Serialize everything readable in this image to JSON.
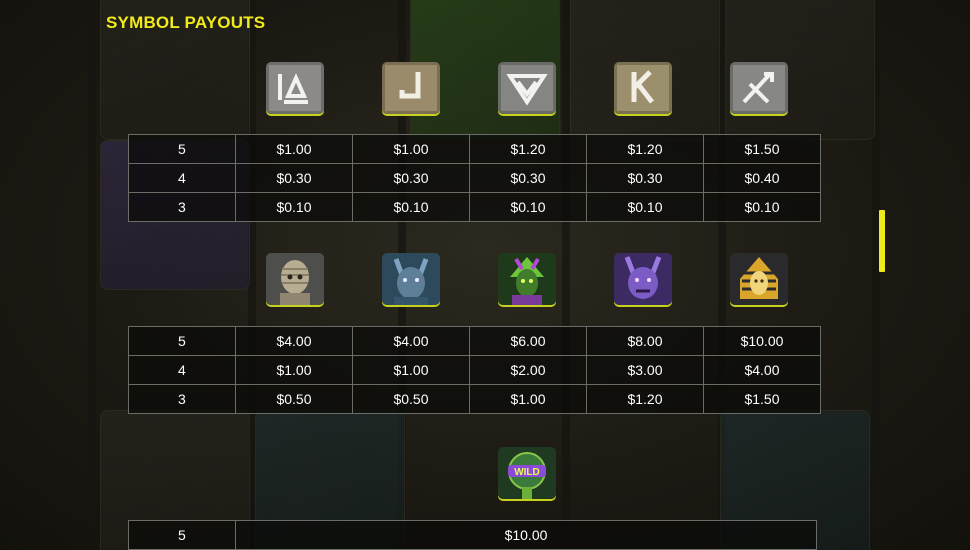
{
  "title": "SYMBOL PAYOUTS",
  "low_symbols": {
    "icons": [
      "ten-rune-icon",
      "jack-rune-icon",
      "queen-rune-icon",
      "king-rune-icon",
      "ace-rune-icon"
    ],
    "rows": [
      {
        "count": "5",
        "values": [
          "$1.00",
          "$1.00",
          "$1.20",
          "$1.20",
          "$1.50"
        ]
      },
      {
        "count": "4",
        "values": [
          "$0.30",
          "$0.30",
          "$0.30",
          "$0.30",
          "$0.40"
        ]
      },
      {
        "count": "3",
        "values": [
          "$0.10",
          "$0.10",
          "$0.10",
          "$0.10",
          "$0.10"
        ]
      }
    ]
  },
  "high_symbols": {
    "icons": [
      "mummy-icon",
      "blue-anubis-icon",
      "green-pharaoh-icon",
      "purple-anubis-icon",
      "gold-pharaoh-icon"
    ],
    "rows": [
      {
        "count": "5",
        "values": [
          "$4.00",
          "$4.00",
          "$6.00",
          "$8.00",
          "$10.00"
        ]
      },
      {
        "count": "4",
        "values": [
          "$1.00",
          "$1.00",
          "$2.00",
          "$3.00",
          "$4.00"
        ]
      },
      {
        "count": "3",
        "values": [
          "$0.50",
          "$0.50",
          "$1.00",
          "$1.20",
          "$1.50"
        ]
      }
    ]
  },
  "wild": {
    "icon": "wild-symbol-icon",
    "label": "WILD",
    "rows": [
      {
        "count": "5",
        "value": "$10.00"
      }
    ]
  },
  "colors": {
    "accent": "#f1ea1a",
    "table_border": "#6c6c66",
    "text": "#ffffff"
  }
}
